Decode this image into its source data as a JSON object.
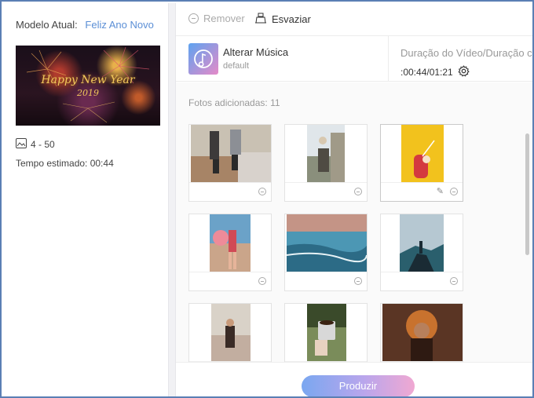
{
  "left_panel": {
    "model_label": "Modelo Atual:",
    "model_value": "Feliz Ano Novo",
    "thumbnail_title": "Happy New Year",
    "thumbnail_year": "2019",
    "photo_range": "4 - 50",
    "estimated_time": "Tempo estimado: 00:44"
  },
  "toolbar": {
    "remove_label": "Remover",
    "empty_label": "Esvaziar"
  },
  "music": {
    "title": "Alterar Música",
    "subtitle": "default",
    "duration_label": "Duração do Vídeo/Duração c",
    "duration_value": ":00:44/01:21"
  },
  "photos": {
    "count_label": "Fotos adicionadas: 11",
    "items": [
      {
        "name": "photo-1",
        "colors": [
          "#c9c1b3",
          "#a78466",
          "#3d3a3a"
        ]
      },
      {
        "name": "photo-2",
        "colors": [
          "#e0e6ea",
          "#8a8f7c",
          "#4f4b43"
        ]
      },
      {
        "name": "photo-3",
        "colors": [
          "#f2c21d",
          "#e8bf1a",
          "#d43a3f"
        ]
      },
      {
        "name": "photo-4",
        "colors": [
          "#6ba2c8",
          "#ee8b99",
          "#d04a55"
        ]
      },
      {
        "name": "photo-5",
        "colors": [
          "#c49486",
          "#4c97b4",
          "#2c6b86"
        ]
      },
      {
        "name": "photo-6",
        "colors": [
          "#b6c8d2",
          "#2a5f6d",
          "#1a2b34"
        ]
      },
      {
        "name": "photo-7",
        "colors": [
          "#d9d2c8",
          "#c2aea0",
          "#3a2b26"
        ]
      },
      {
        "name": "photo-8",
        "colors": [
          "#3a4a2a",
          "#7a8c5a",
          "#d8d8d8"
        ]
      },
      {
        "name": "photo-9",
        "colors": [
          "#5a3524",
          "#c8722e",
          "#2e1a12"
        ]
      }
    ]
  },
  "footer": {
    "produce_label": "Produzir"
  }
}
